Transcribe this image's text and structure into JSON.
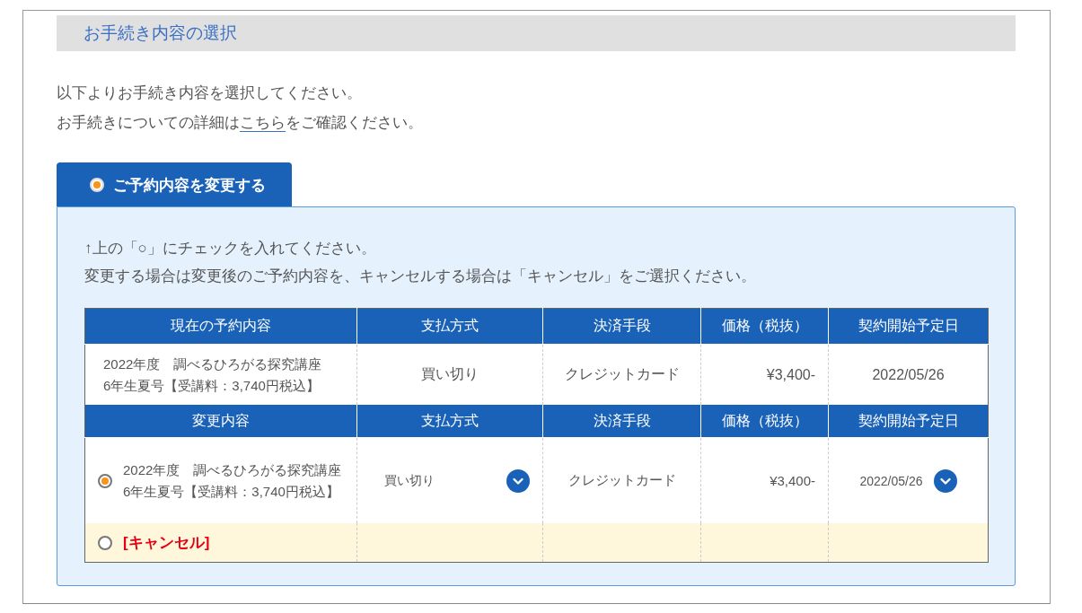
{
  "section_title": "お手続き内容の選択",
  "intro": {
    "line1": "以下よりお手続き内容を選択してください。",
    "line2_before": "お手続きについての詳細は",
    "line2_link": "こちら",
    "line2_after": "をご確認ください。"
  },
  "tab": {
    "label": "ご予約内容を変更する",
    "selected": true
  },
  "instructions": [
    "↑上の「○」にチェックを入れてください。",
    "変更する場合は変更後のご予約内容を、キャンセルする場合は「キャンセル」をご選択ください。"
  ],
  "current": {
    "columns": [
      "現在の予約内容",
      "支払方式",
      "決済手段",
      "価格（税抜）",
      "契約開始予定日"
    ],
    "row": [
      "2022年度　調べるひろがる探究講座\n6年生夏号【受講料：3,740円税込】",
      "買い切り",
      "クレジットカード",
      "¥3,400-",
      "2022/05/26"
    ]
  },
  "change": {
    "columns": [
      "変更内容",
      "支払方式",
      "決済手段",
      "価格（税抜）",
      "契約開始予定日"
    ],
    "options": [
      {
        "kind": "plan",
        "selected": true,
        "cells": [
          {
            "text": "2022年度　調べるひろがる探究講座　6年生夏号【受講料：3,740円税込】"
          },
          {
            "text": "買い切り",
            "dropdown": true
          },
          {
            "text": "クレジットカード",
            "dropdown": false
          },
          {
            "text": "¥3,400-",
            "dropdown": false
          },
          {
            "text": "2022/05/26",
            "dropdown": true
          }
        ]
      },
      {
        "kind": "cancel",
        "selected": false,
        "label": "[キャンセル]"
      }
    ]
  }
}
